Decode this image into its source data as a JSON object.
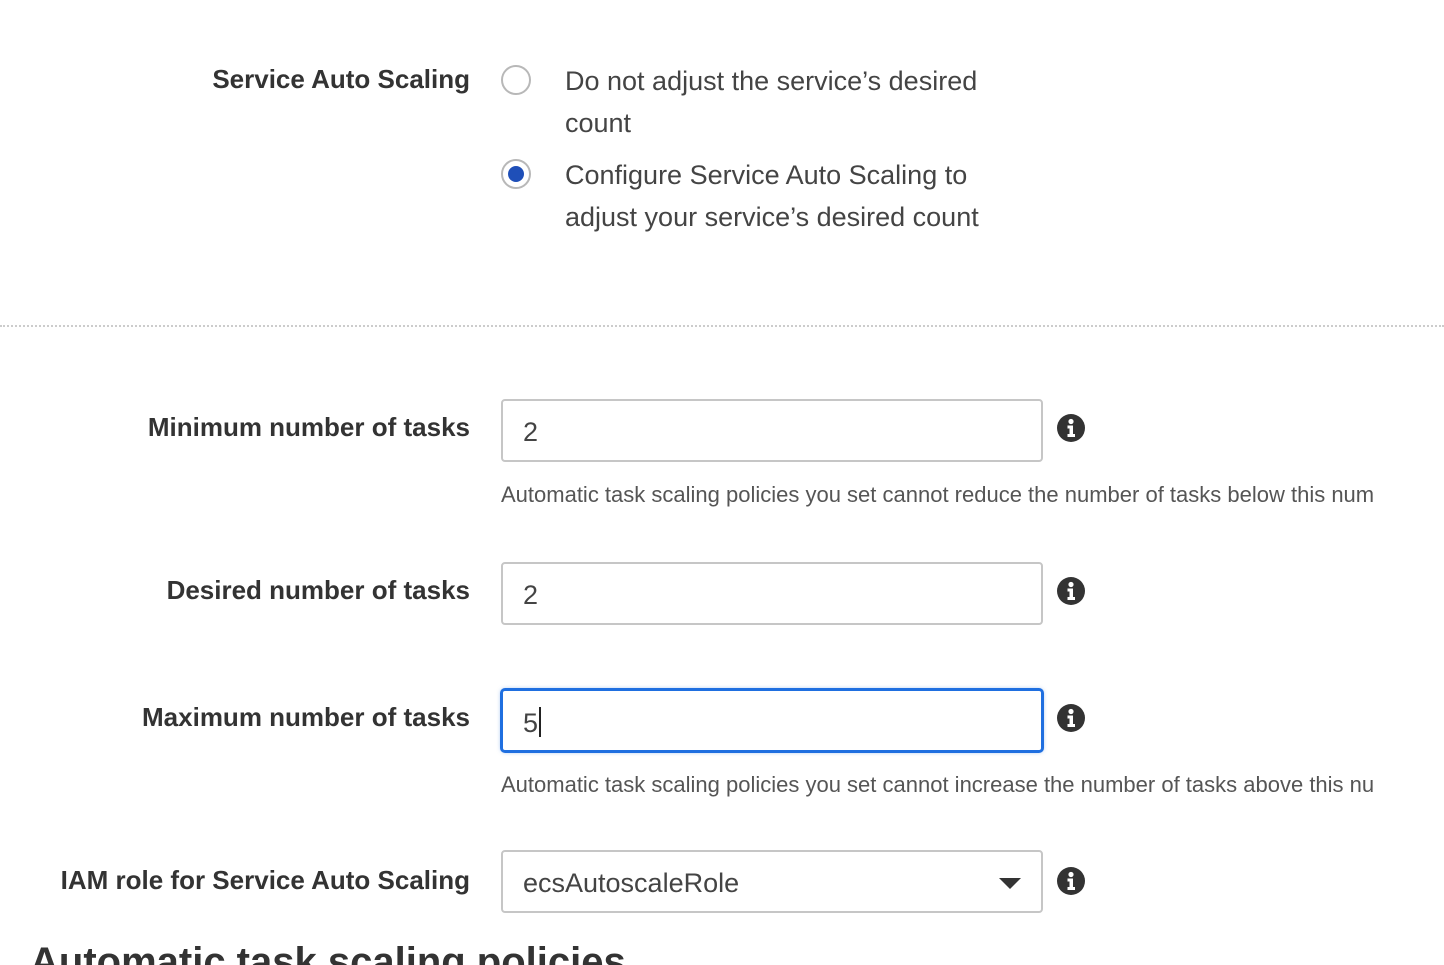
{
  "autoscaling": {
    "label": "Service Auto Scaling",
    "options": [
      {
        "label": "Do not adjust the service’s desired count",
        "selected": false
      },
      {
        "label": "Configure Service Auto Scaling to adjust your service’s desired count",
        "selected": true
      }
    ]
  },
  "min_tasks": {
    "label": "Minimum number of tasks",
    "value": "2",
    "help": "Automatic task scaling policies you set cannot reduce the number of tasks below this num"
  },
  "desired_tasks": {
    "label": "Desired number of tasks",
    "value": "2"
  },
  "max_tasks": {
    "label": "Maximum number of tasks",
    "value": "5",
    "help": "Automatic task scaling policies you set cannot increase the number of tasks above this nu"
  },
  "iam_role": {
    "label": "IAM role for Service Auto Scaling",
    "value": "ecsAutoscaleRole"
  },
  "next_section": {
    "heading": "Automatic task scaling policies"
  },
  "icons": {
    "info": "info-icon",
    "dropdown": "chevron-down-icon"
  },
  "colors": {
    "radio_selected": "#1f4fb8",
    "focus_border": "#1f6fe0",
    "label_text": "#333333",
    "body_text": "#444444"
  }
}
